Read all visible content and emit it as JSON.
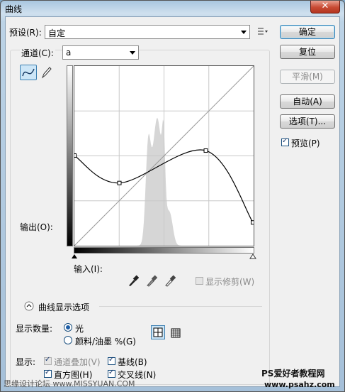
{
  "window": {
    "title": "曲线",
    "close_glyph": "✕"
  },
  "preset": {
    "label": "预设(R):",
    "value": "自定",
    "options_icon": "preset-menu-icon"
  },
  "channel": {
    "label": "通道(C):",
    "value": "a"
  },
  "buttons": {
    "ok": "确定",
    "reset": "复位",
    "smooth": "平滑(M)",
    "auto": "自动(A)",
    "options": "选项(T)..."
  },
  "preview": {
    "label": "预览(P)",
    "checked": true
  },
  "curve": {
    "output_label": "输出(O):",
    "input_label": "输入(I):",
    "show_clipping": "显示修剪(W)",
    "show_clipping_checked": false,
    "points": [
      [
        0,
        128
      ],
      [
        64,
        89
      ],
      [
        187,
        135
      ],
      [
        254,
        33
      ]
    ],
    "grid_divisions": 4,
    "histogram_color": "#d6d6d6",
    "curve_color": "#000000",
    "diagonal_color": "#9a9a9a"
  },
  "display_options": {
    "title": "曲线显示选项",
    "amount_label": "显示数量:",
    "light": "光",
    "pigment": "颜料/油墨 %(G)",
    "light_selected": true,
    "show_label": "显示:",
    "channel_overlays": "通道叠加(V)",
    "baseline": "基线(B)",
    "histogram": "直方图(H)",
    "intersection": "交叉线(N)",
    "channel_overlays_checked": true,
    "baseline_checked": true,
    "histogram_checked": true,
    "intersection_checked": true
  },
  "watermarks": {
    "left": "思缘设计论坛 www.MISSYUAN.COM",
    "right": "PS爱好者教程网",
    "right_url": "www.psahz.com"
  }
}
